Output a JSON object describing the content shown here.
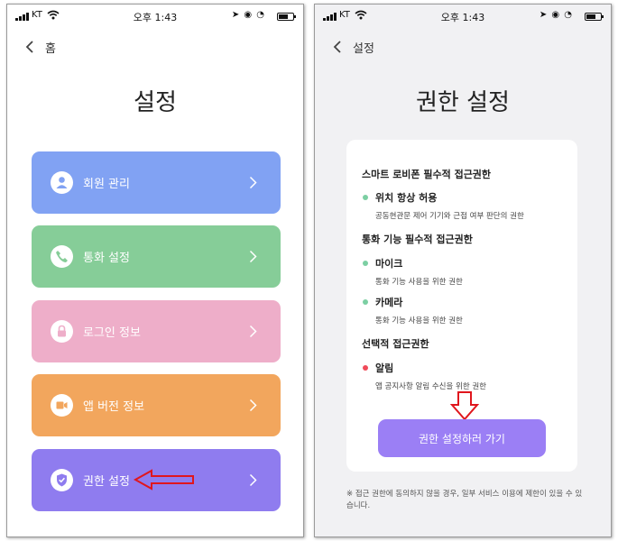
{
  "colors": {
    "menu_1": "#81a2f3",
    "menu_2": "#86cd98",
    "menu_3": "#eeaec9",
    "menu_4": "#f2a65d",
    "menu_5": "#8f7cef",
    "accent": "#9b7ff5",
    "dot_green": "#7ccfa3",
    "dot_red": "#f04b5a",
    "annotation_red": "#e0161d"
  },
  "left_screen": {
    "status_bar": {
      "carrier": "KT",
      "time": "오후 1:43"
    },
    "nav": {
      "back_label": "홈"
    },
    "title": "설정",
    "menu": [
      {
        "label": "회원 관리",
        "icon": "user-icon"
      },
      {
        "label": "통화 설정",
        "icon": "phone-icon"
      },
      {
        "label": "로그인 정보",
        "icon": "lock-icon"
      },
      {
        "label": "앱 버전 정보",
        "icon": "video-icon"
      },
      {
        "label": "권한 설정",
        "icon": "shield-check-icon"
      }
    ]
  },
  "right_screen": {
    "status_bar": {
      "carrier": "KT",
      "time": "오후 1:43"
    },
    "nav": {
      "back_label": "설정"
    },
    "title": "권한 설정",
    "sections": [
      {
        "heading": "스마트 로비폰 필수적 접근권한",
        "items": [
          {
            "title": "위치 항상 허용",
            "desc": "공동현관문 제어 기기와 근접 여부 판단의 권한"
          }
        ]
      },
      {
        "heading": "통화 기능 필수적 접근권한",
        "items": [
          {
            "title": "마이크",
            "desc": "통화 기능 사용을 위한 권한"
          },
          {
            "title": "카메라",
            "desc": "통화 기능 사용을 위한 권한"
          }
        ]
      },
      {
        "heading": "선택적 접근권한",
        "items": [
          {
            "title": "알림",
            "desc": "앱 공지사항 알림 수신을 위한 권한"
          }
        ]
      }
    ],
    "cta_label": "권한 설정하러 가기",
    "footnote": "※ 접근 권한에 동의하지 않을 경우, 일부 서비스 이용에 제한이 있을 수 있습니다."
  }
}
